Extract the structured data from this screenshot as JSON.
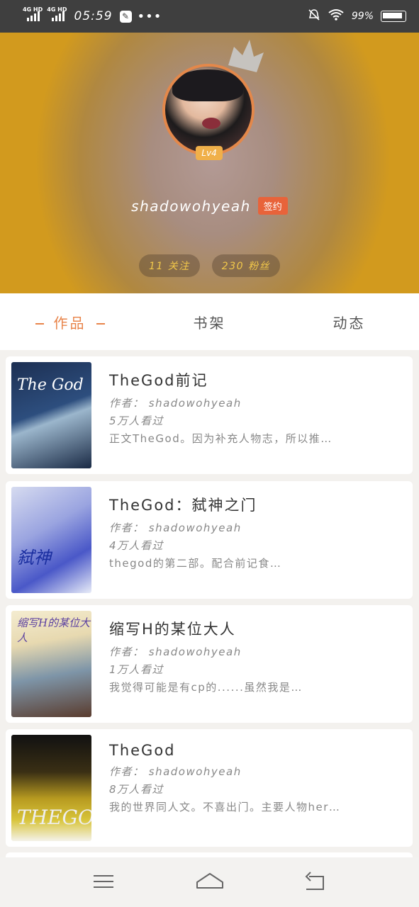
{
  "status_bar": {
    "sim1": "4G HD",
    "sim2": "4G HD",
    "time": "05:59",
    "dots": "•••",
    "battery": "99%"
  },
  "profile": {
    "username": "shadowohyeah",
    "level": "Lv4",
    "signed_badge": "签约",
    "following": "11 关注",
    "followers": "230 粉丝"
  },
  "tabs": [
    {
      "label": "作品",
      "active": true
    },
    {
      "label": "书架",
      "active": false
    },
    {
      "label": "动态",
      "active": false
    }
  ],
  "works": [
    {
      "title": "TheGod前记",
      "author": "作者： shadowohyeah",
      "views": "5万人看过",
      "description": "正文TheGod。因为补充人物志，所以推…",
      "cover_text": "The God"
    },
    {
      "title": "TheGod：弑神之门",
      "author": "作者： shadowohyeah",
      "views": "4万人看过",
      "description": "thegod的第二部。配合前记食…",
      "cover_text": "弑神"
    },
    {
      "title": "缩写H的某位大人",
      "author": "作者： shadowohyeah",
      "views": "1万人看过",
      "description": "我觉得可能是有cp的......虽然我是…",
      "cover_text": "缩写H的某位大人"
    },
    {
      "title": "TheGod",
      "author": "作者： shadowohyeah",
      "views": "8万人看过",
      "description": "我的世界同人文。不喜出门。主要人物her…",
      "cover_text": "THEGOD"
    }
  ],
  "colors": {
    "accent": "#e8844a",
    "signed_badge": "#e8633a",
    "level_badge": "#f0b04a"
  }
}
